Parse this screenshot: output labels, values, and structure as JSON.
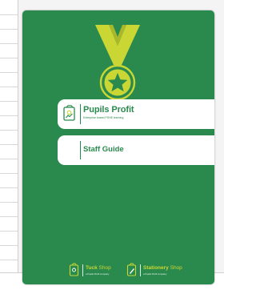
{
  "colors": {
    "page_green": "#2a8a4e",
    "accent_lime": "#c9d634",
    "card_white": "#ffffff"
  },
  "cover": {
    "medal_icon": "medal-star-icon",
    "brand": {
      "title": "Pupils Profit",
      "tagline": "Enterprise based PSHE learning"
    },
    "guide_title": "Staff Guide",
    "footer_logos": [
      {
        "icon": "tuck-shop-icon",
        "name": "Tuck",
        "name_suffix": "Shop",
        "sub": "a Pupils Profit company"
      },
      {
        "icon": "stationery-shop-icon",
        "name": "Stationery",
        "name_suffix": "Shop",
        "sub": "a Pupils Profit company"
      }
    ]
  }
}
